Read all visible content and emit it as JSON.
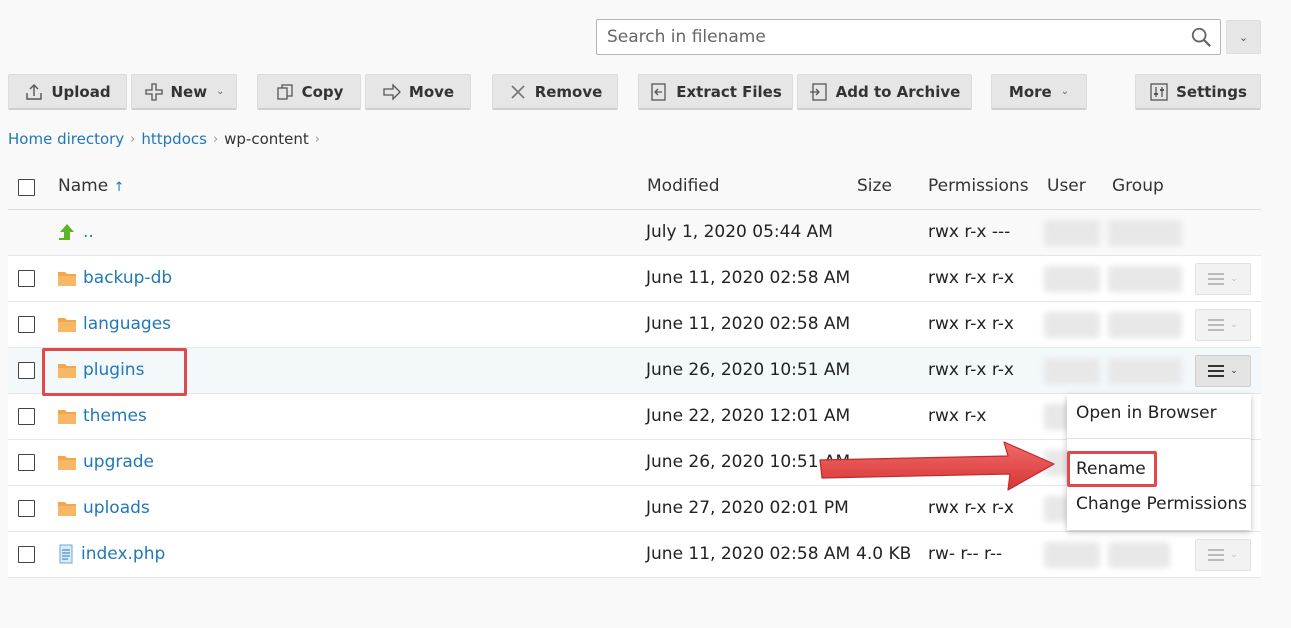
{
  "search": {
    "placeholder": "Search in filename"
  },
  "toolbar": {
    "upload": "Upload",
    "new": "New",
    "copy": "Copy",
    "move": "Move",
    "remove": "Remove",
    "extract": "Extract Files",
    "archive": "Add to Archive",
    "more": "More",
    "settings": "Settings"
  },
  "breadcrumb": {
    "home": "Home directory",
    "httpdocs": "httpdocs",
    "current": "wp-content"
  },
  "table": {
    "headers": {
      "name": "Name",
      "sort_indicator": "↑",
      "modified": "Modified",
      "size": "Size",
      "permissions": "Permissions",
      "user": "User",
      "group": "Group"
    },
    "rows": [
      {
        "name": "..",
        "type": "parent-up",
        "modified": "July 1, 2020 05:44 AM",
        "size": "",
        "permissions": "rwx r-x ---"
      },
      {
        "name": "backup-db",
        "type": "folder",
        "modified": "June 11, 2020 02:58 AM",
        "size": "",
        "permissions": "rwx r-x r-x"
      },
      {
        "name": "languages",
        "type": "folder",
        "modified": "June 11, 2020 02:58 AM",
        "size": "",
        "permissions": "rwx r-x r-x"
      },
      {
        "name": "plugins",
        "type": "folder",
        "modified": "June 26, 2020 10:51 AM",
        "size": "",
        "permissions": "rwx r-x r-x"
      },
      {
        "name": "themes",
        "type": "folder",
        "modified": "June 22, 2020 12:01 AM",
        "size": "",
        "permissions": "rwx r-x"
      },
      {
        "name": "upgrade",
        "type": "folder",
        "modified": "June 26, 2020 10:51 AM",
        "size": "",
        "permissions": ""
      },
      {
        "name": "uploads",
        "type": "folder",
        "modified": "June 27, 2020 02:01 PM",
        "size": "",
        "permissions": "rwx r-x r-x"
      },
      {
        "name": "index.php",
        "type": "file",
        "modified": "June 11, 2020 02:58 AM",
        "size": "4.0 KB",
        "permissions": "rw- r-- r--"
      }
    ]
  },
  "context_menu": {
    "open_in_browser": "Open in Browser",
    "rename": "Rename",
    "change_permissions": "Change Permissions"
  },
  "colors": {
    "link": "#2178b7",
    "highlight": "#e04a4a",
    "folder": "#f5a54a",
    "button_bg": "#e6e6e6"
  }
}
